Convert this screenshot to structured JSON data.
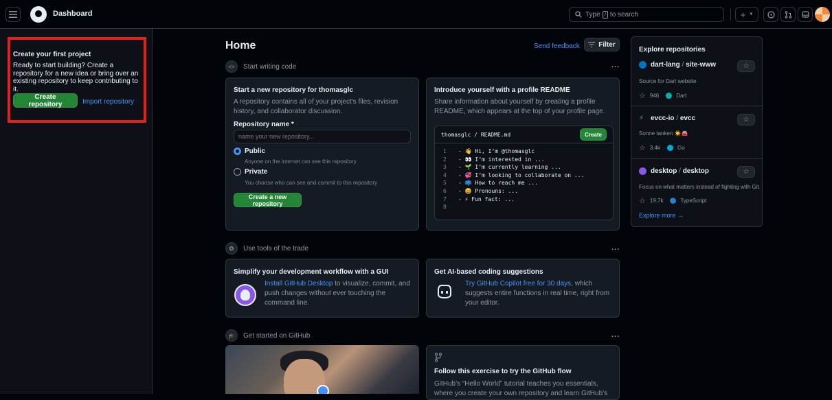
{
  "header": {
    "title": "Dashboard",
    "search_placeholder_pre": "Type",
    "search_key": "/",
    "search_placeholder_post": "to search",
    "plus_label": "+"
  },
  "left": {
    "title": "Create your first project",
    "description": "Ready to start building? Create a repository for a new idea or bring over an existing repository to keep contributing to it.",
    "create_button": "Create repository",
    "import_link": "Import repository"
  },
  "main": {
    "title": "Home",
    "feedback": "Send feedback",
    "filter": "Filter",
    "dots": "...",
    "sections": {
      "writing": "Start writing code",
      "tools": "Use tools of the trade",
      "started": "Get started on GitHub"
    },
    "new_repo": {
      "title": "Start a new repository for thomasglc",
      "description": "A repository contains all of your project's files, revision history, and collaborator discussion.",
      "name_label": "Repository name *",
      "name_placeholder": "name your new repository...",
      "public_label": "Public",
      "public_sub": "Anyone on the internet can see this repository",
      "private_label": "Private",
      "private_sub": "You choose who can see and commit to this repository",
      "create_button": "Create a new repository"
    },
    "readme": {
      "title": "Introduce yourself with a profile README",
      "description": "Share information about yourself by creating a profile README, which appears at the top of your profile page.",
      "user": "thomasglc",
      "sep": " / ",
      "file": "README.md",
      "create_button": "Create",
      "lines": [
        {
          "n": "1",
          "text": "- 👋 Hi, I’m @thomasglc"
        },
        {
          "n": "2",
          "text": "- 👀 I’m interested in ..."
        },
        {
          "n": "3",
          "text": "- 🌱 I’m currently learning ..."
        },
        {
          "n": "4",
          "text": "- 💞️ I’m looking to collaborate on ..."
        },
        {
          "n": "5",
          "text": "- 📫 How to reach me ..."
        },
        {
          "n": "6",
          "text": "- 😄 Pronouns: ..."
        },
        {
          "n": "7",
          "text": "- ⚡ Fun fact: ..."
        },
        {
          "n": "8",
          "text": ""
        }
      ]
    },
    "gui": {
      "title": "Simplify your development workflow with a GUI",
      "link": "Install GitHub Desktop",
      "rest": " to visualize, commit, and push changes without ever touching the command line."
    },
    "copilot": {
      "title": "Get AI-based coding suggestions",
      "link": "Try GitHub Copilot free for 30 days,",
      "rest": " which suggests entire functions in real time, right from your editor."
    },
    "flow": {
      "title": "Follow this exercise to try the GitHub flow",
      "description": "GitHub’s “Hello World” tutorial teaches you essentials, where you create your own repository and learn GitHub’s pull request"
    }
  },
  "explore": {
    "title": "Explore repositories",
    "repos": [
      {
        "owner": "dart-lang",
        "name": "site-www",
        "description": "Source for Dart website",
        "stars": "946",
        "language": "Dart",
        "lang_color": "#00b4ab",
        "icon_color": "#0175c2"
      },
      {
        "owner": "evcc-io",
        "name": "evcc",
        "description": "Sonne tanken ☀️🚘",
        "stars": "3.4k",
        "language": "Go",
        "lang_color": "#00add8",
        "icon_color": "#3fb950"
      },
      {
        "owner": "desktop",
        "name": "desktop",
        "description": "Focus on what matters instead of fighting with Git.",
        "stars": "19.7k",
        "language": "TypeScript",
        "lang_color": "#3178c6",
        "icon_color": "#8957e5"
      }
    ],
    "more": "Explore more →"
  }
}
